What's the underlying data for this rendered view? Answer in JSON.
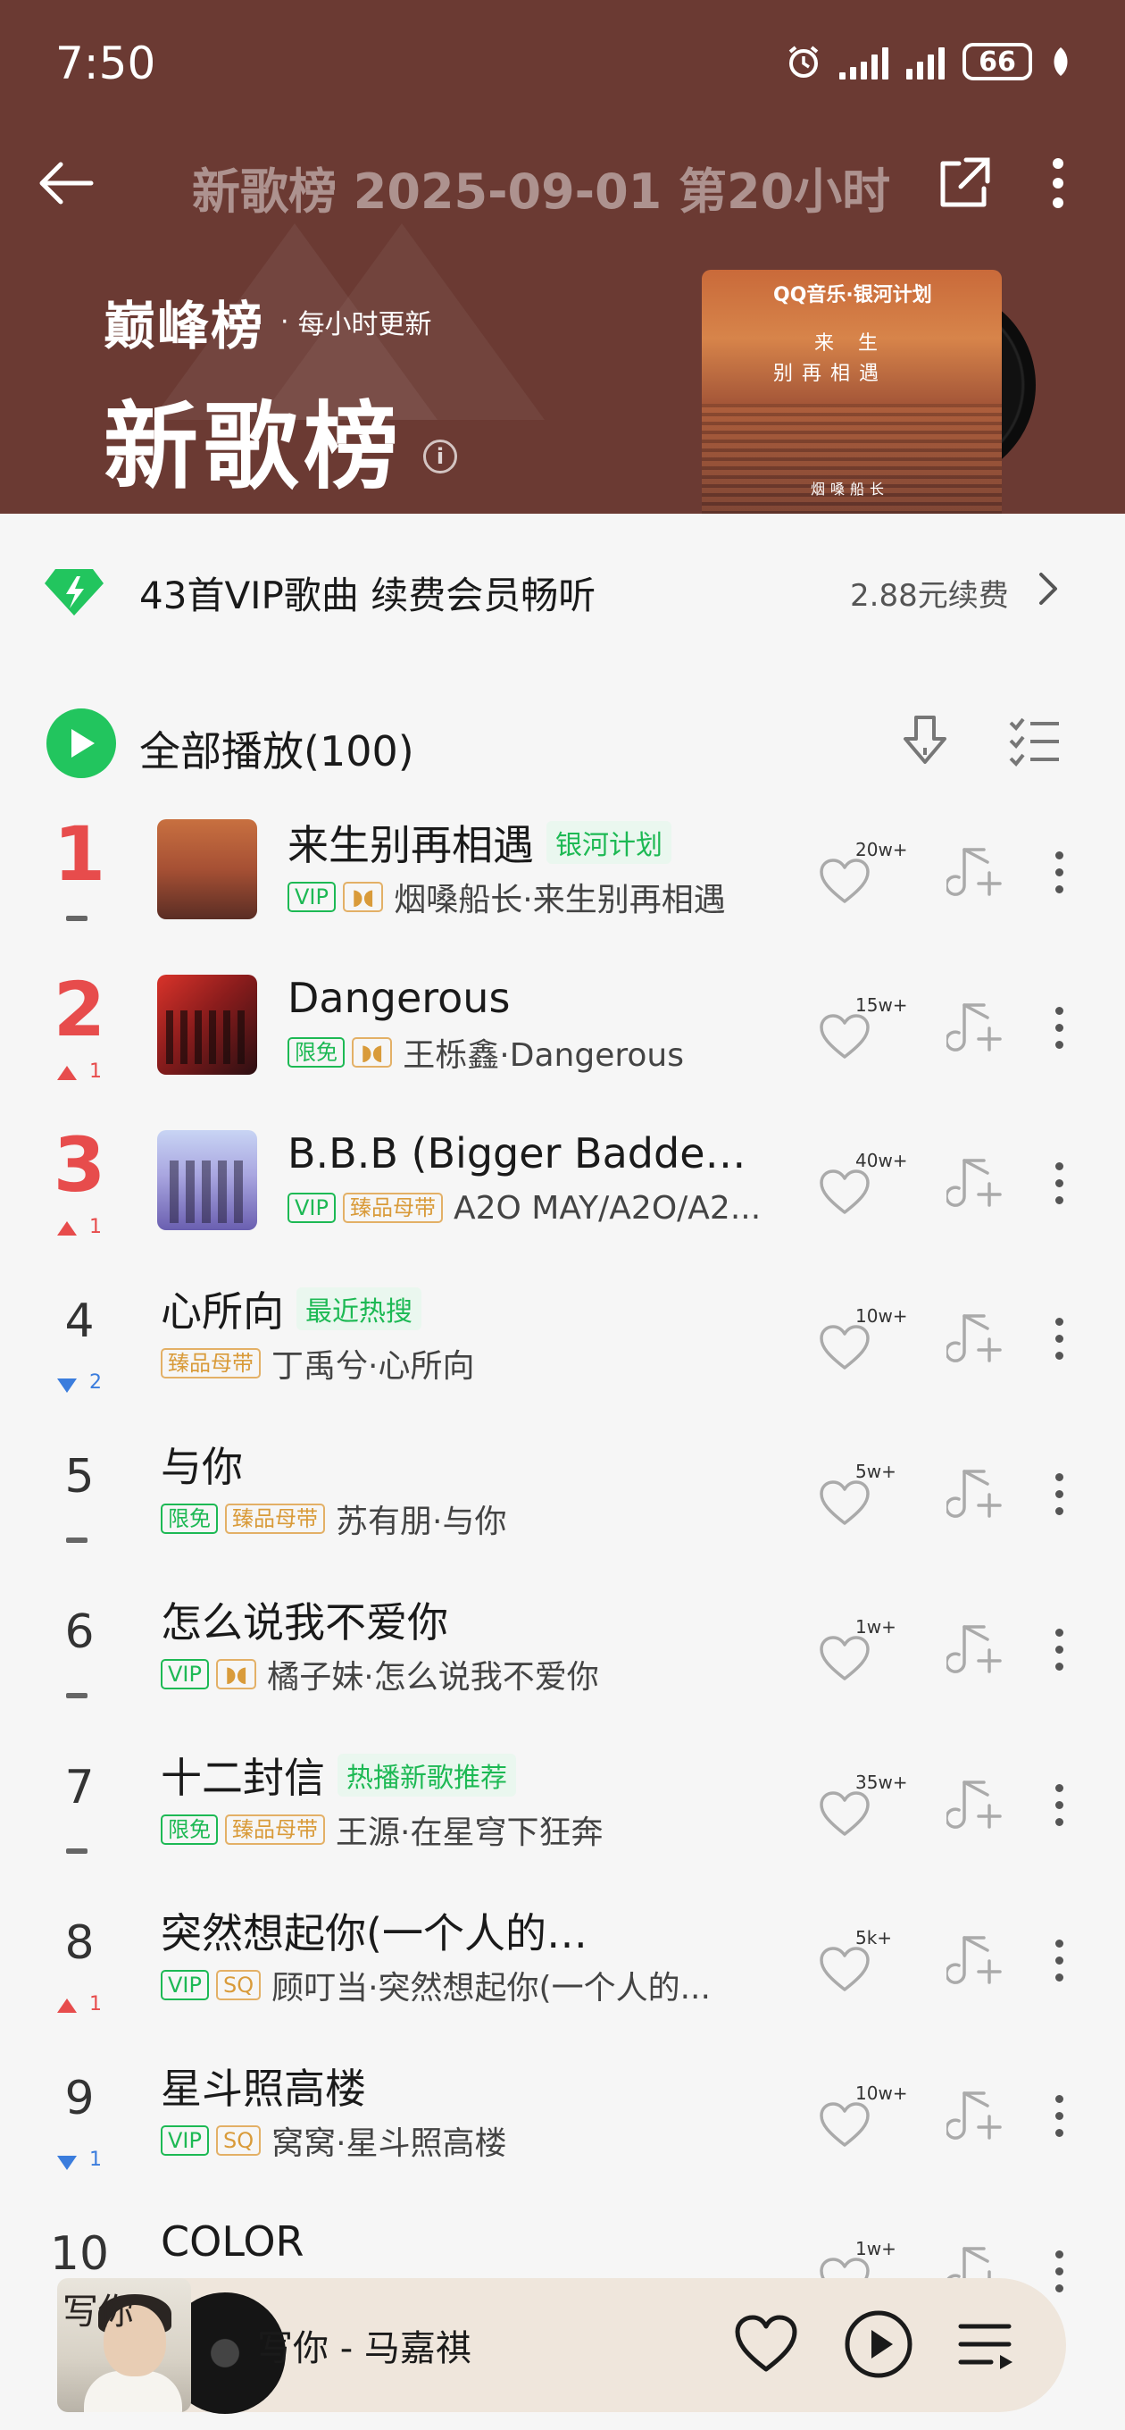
{
  "status_bar": {
    "time": "7:50",
    "battery": "66"
  },
  "nav": {
    "title": "新歌榜 2025-09-01 第20小时"
  },
  "banner": {
    "brand": "巅峰榜",
    "dot": "·",
    "subtitle": "每小时更新",
    "title": "新歌榜",
    "info": "i",
    "cover": {
      "logo": "QQ音乐·银河计划",
      "line1": "来 生",
      "line2": "别再相遇",
      "artist": "烟嗓船长"
    }
  },
  "vip": {
    "text": "43首VIP歌曲 续费会员畅听",
    "price": "2.88元续费"
  },
  "playall": {
    "label": "全部播放(100)"
  },
  "colors": {
    "header_bg": "#6b3a33",
    "accent_green": "#22c55e",
    "rank_red": "#e74c4c",
    "trend_down_blue": "#3b7ddd",
    "gold_badge": "#d99b3a"
  },
  "songs": [
    {
      "rank": "1",
      "top": true,
      "trend": "same",
      "trend_num": "",
      "thumb": true,
      "title": "来生别再相遇",
      "tag": "银河计划",
      "badges": [
        {
          "type": "vip",
          "label": "VIP"
        },
        {
          "type": "dolby",
          "label": "◗◖"
        }
      ],
      "artist": "烟嗓船长·来生别再相遇",
      "likes": "20w+"
    },
    {
      "rank": "2",
      "top": true,
      "trend": "up",
      "trend_num": "1",
      "thumb": true,
      "title": "Dangerous",
      "tag": "",
      "badges": [
        {
          "type": "free",
          "label": "限免"
        },
        {
          "type": "dolby",
          "label": "◗◖"
        }
      ],
      "artist": "王栎鑫·Dangerous",
      "likes": "15w+"
    },
    {
      "rank": "3",
      "top": true,
      "trend": "up",
      "trend_num": "1",
      "thumb": true,
      "title": "B.B.B (Bigger Badder...",
      "tag": "",
      "badges": [
        {
          "type": "vip",
          "label": "VIP"
        },
        {
          "type": "master",
          "label": "臻品母带"
        }
      ],
      "artist": "A2O MAY/A2O/A2...",
      "likes": "40w+"
    },
    {
      "rank": "4",
      "top": false,
      "trend": "down",
      "trend_num": "2",
      "thumb": false,
      "title": "心所向",
      "tag": "最近热搜",
      "badges": [
        {
          "type": "master",
          "label": "臻品母带"
        }
      ],
      "artist": "丁禹兮·心所向",
      "likes": "10w+"
    },
    {
      "rank": "5",
      "top": false,
      "trend": "same",
      "trend_num": "",
      "thumb": false,
      "title": "与你",
      "tag": "",
      "badges": [
        {
          "type": "free",
          "label": "限免"
        },
        {
          "type": "master",
          "label": "臻品母带"
        }
      ],
      "artist": "苏有朋·与你",
      "likes": "5w+"
    },
    {
      "rank": "6",
      "top": false,
      "trend": "same",
      "trend_num": "",
      "thumb": false,
      "title": "怎么说我不爱你",
      "tag": "",
      "badges": [
        {
          "type": "vip",
          "label": "VIP"
        },
        {
          "type": "dolby",
          "label": "◗◖"
        }
      ],
      "artist": "橘子妹·怎么说我不爱你",
      "likes": "1w+"
    },
    {
      "rank": "7",
      "top": false,
      "trend": "same",
      "trend_num": "",
      "thumb": false,
      "title": "十二封信",
      "tag": "热播新歌推荐",
      "badges": [
        {
          "type": "free",
          "label": "限免"
        },
        {
          "type": "master",
          "label": "臻品母带"
        }
      ],
      "artist": "王源·在星穹下狂奔",
      "likes": "35w+"
    },
    {
      "rank": "8",
      "top": false,
      "trend": "up",
      "trend_num": "1",
      "thumb": false,
      "title": "突然想起你(一个人的夜我的...",
      "tag": "",
      "badges": [
        {
          "type": "vip",
          "label": "VIP"
        },
        {
          "type": "sq",
          "label": "SQ"
        }
      ],
      "artist": "顾叮当·突然想起你(一个人的...",
      "likes": "5k+"
    },
    {
      "rank": "9",
      "top": false,
      "trend": "down",
      "trend_num": "1",
      "thumb": false,
      "title": "星斗照高楼",
      "tag": "",
      "badges": [
        {
          "type": "vip",
          "label": "VIP"
        },
        {
          "type": "sq",
          "label": "SQ"
        }
      ],
      "artist": "窝窝·星斗照高楼",
      "likes": "10w+"
    },
    {
      "rank": "10",
      "top": false,
      "trend": "same",
      "trend_num": "",
      "thumb": false,
      "title": "COLOR",
      "tag": "",
      "badges": [],
      "artist": "",
      "likes": "1w+"
    }
  ],
  "mini_player": {
    "title": "写你 - 马嘉祺",
    "cover_text": "写你"
  }
}
